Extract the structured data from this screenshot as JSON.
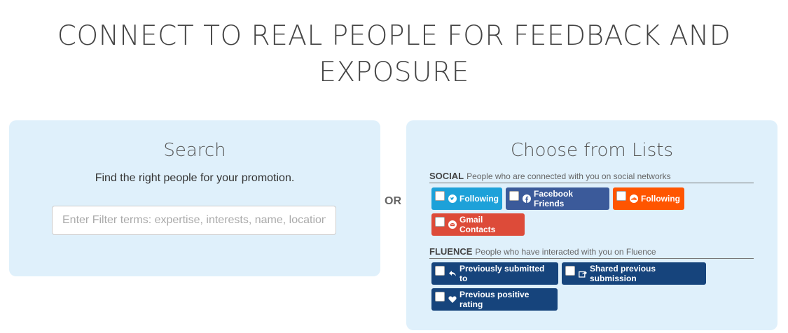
{
  "headline": {
    "line1": "CONNECT TO REAL PEOPLE FOR FEEDBACK AND",
    "line2": "EXPOSURE"
  },
  "search": {
    "title": "Search",
    "subtitle": "Find the right people for your promotion.",
    "placeholder": "Enter Filter terms: expertise, interests, name, location"
  },
  "or_label": "OR",
  "lists": {
    "title": "Choose from Lists",
    "social": {
      "name": "SOCIAL",
      "description": "People who are connected with you on social networks",
      "buttons": [
        {
          "label": "Following",
          "icon": "twitter-icon",
          "color": "#1da1d9"
        },
        {
          "label": "Facebook Friends",
          "icon": "facebook-icon",
          "color": "#3b5a9a"
        },
        {
          "label": "Following",
          "icon": "soundcloud-icon",
          "color": "#ff5500"
        },
        {
          "label": "Gmail Contacts",
          "icon": "gmail-icon",
          "color": "#dd4b39"
        }
      ]
    },
    "fluence": {
      "name": "FLUENCE",
      "description": "People who have interacted with you on Fluence",
      "buttons": [
        {
          "label": "Previously submitted to",
          "icon": "reply-icon",
          "color": "#16447c"
        },
        {
          "label": "Shared previous submission",
          "icon": "share-icon",
          "color": "#16447c"
        },
        {
          "label": "Previous positive rating",
          "icon": "heart-icon",
          "color": "#16447c"
        }
      ]
    }
  }
}
